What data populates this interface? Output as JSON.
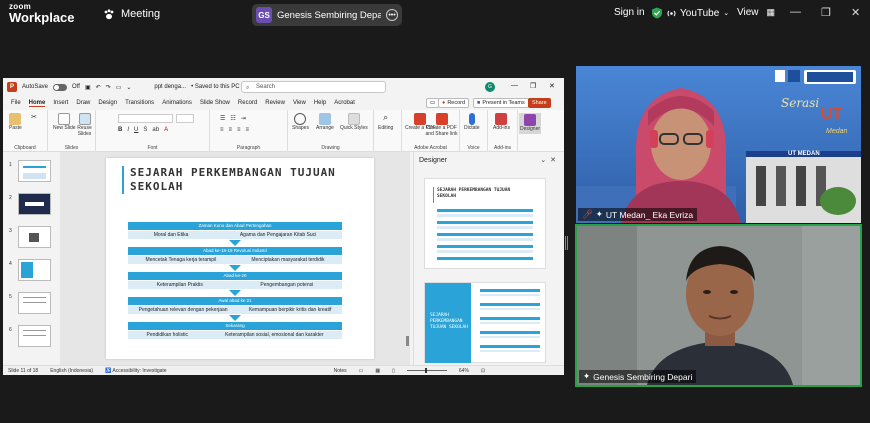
{
  "zoom": {
    "logo_line1": "zoom",
    "logo_line2": "Workplace",
    "meeting_label": "Meeting",
    "share_initials": "GS",
    "share_label": "Genesis Sembiring Depari's scree",
    "sign_in": "Sign in",
    "youtube_label": "YouTube",
    "view_label": "View"
  },
  "ppt": {
    "autosave": "AutoSave",
    "autosave_state": "Off",
    "file_title": "ppt denga...",
    "saved_state": "• Saved to this PC",
    "search_placeholder": "Search",
    "user_initial": "G",
    "menu": [
      "File",
      "Home",
      "Insert",
      "Draw",
      "Design",
      "Transitions",
      "Animations",
      "Slide Show",
      "Record",
      "Review",
      "View",
      "Help",
      "Acrobat"
    ],
    "record_btn": "Record",
    "present_btn": "Present in Teams",
    "share_btn": "Share",
    "ribbon": {
      "paste": "Paste",
      "clipboard": "Clipboard",
      "new_slide": "New Slide",
      "reuse_slides": "Reuse Slides",
      "slides": "Slides",
      "font": "Font",
      "paragraph": "Paragraph",
      "shapes": "Shapes",
      "arrange": "Arrange",
      "quick_styles": "Quick Styles",
      "drawing": "Drawing",
      "editing": "Editing",
      "create_pdf": "Create a PDF",
      "create_pdf_share": "Create a PDF and Share link",
      "adobe_acrobat": "Adobe Acrobat",
      "dictate": "Dictate",
      "voice": "Voice",
      "addins": "Add-ins",
      "addin_group": "Add-ins",
      "designer": "Designer"
    },
    "slide_title_line1": "SEJARAH PERKEMBANGAN TUJUAN",
    "slide_title_line2": "SEKOLAH",
    "flow": [
      {
        "head": "Zaman Kuno dan Abad Pertengahan",
        "left": "Moral dan Etika",
        "right": "Agama dan Pengajaran Kitab Suci"
      },
      {
        "head": "Abad ke-18-19 Revolusi Industri",
        "left": "Mencetak Tenaga kerja terampil",
        "right": "Menciptakan masyarakat terdidik"
      },
      {
        "head": "Abad ke-20",
        "left": "Keterampilan Praktis",
        "right": "Pengembangan potensi"
      },
      {
        "head": "Awal abad ke 21",
        "left": "Pengetahuan relevan dengan pekerjaan",
        "right": "Kemampuan berpikir kritis dan kreatif"
      },
      {
        "head": "Sekarang",
        "left": "Pendidikan holistic",
        "right": "Keterampilan sosial, emosional dan karakter"
      }
    ],
    "designer_title": "Designer",
    "designer_thumb1_title": "SEJARAH PERKEMBANGAN TUJUAN SEKOLAH",
    "designer_thumb2_title": "SEJARAH PERKEMBANGAN TUJUAN SEKOLAH",
    "status": {
      "slide_count": "Slide 11 of 18",
      "language": "English (Indonesia)",
      "accessibility": "Accessibility: Investigate",
      "notes": "Notes",
      "zoom": "64%"
    },
    "thumb_numbers": [
      "1",
      "2",
      "3",
      "4",
      "5",
      "6"
    ]
  },
  "participants": [
    {
      "name": "UT Medan_ Eka Evriza",
      "muted": true
    },
    {
      "name": "Genesis Sembiring Depari",
      "muted": false
    }
  ],
  "banner_text": {
    "serasi": "Serasi",
    "ut": "UT",
    "medan": "Medan",
    "building_sign": "UT MEDAN"
  }
}
